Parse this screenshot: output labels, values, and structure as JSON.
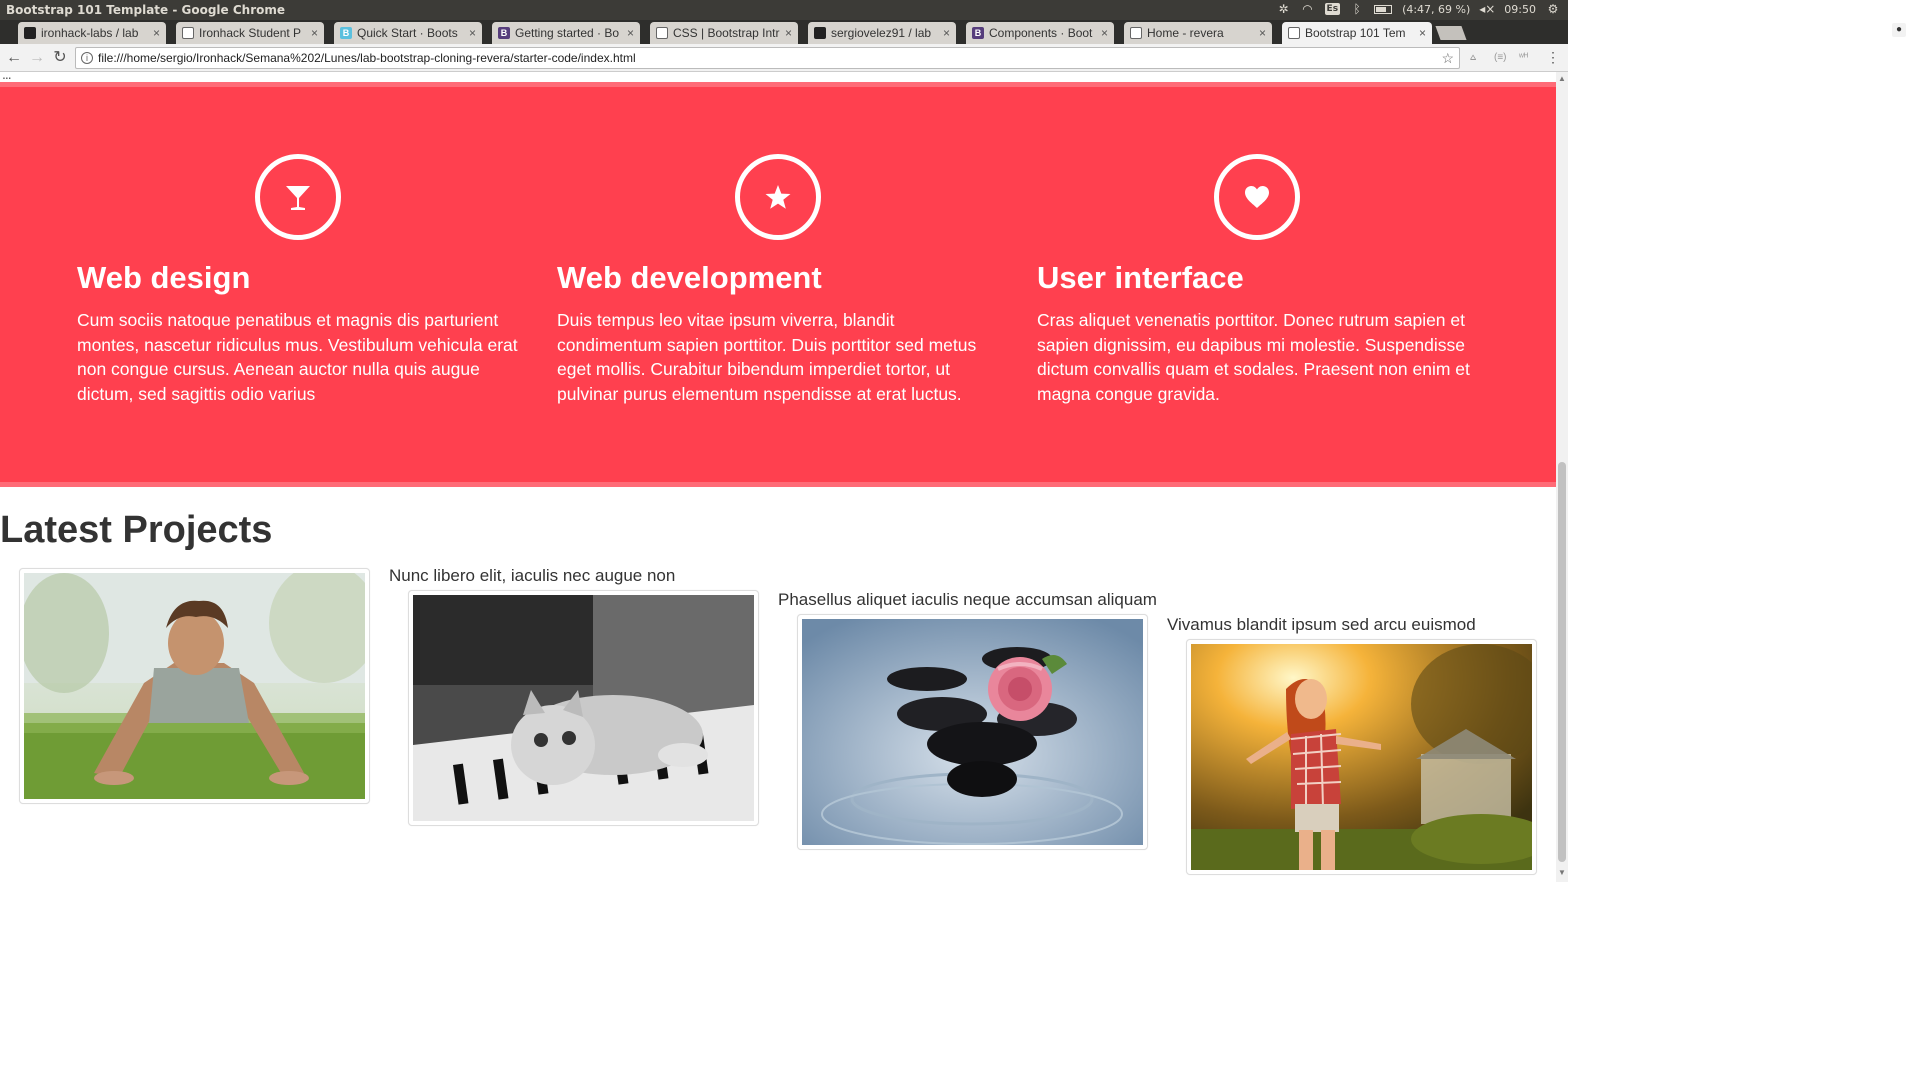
{
  "window": {
    "title": "Bootstrap 101 Template - Google Chrome"
  },
  "tray": {
    "keyboard": "Es",
    "battery": "(4:47, 69 %)",
    "clock": "09:50"
  },
  "tabs": [
    {
      "label": "ironhack-labs / lab",
      "icon": "github-icon"
    },
    {
      "label": "Ironhack Student P",
      "icon": "page-icon"
    },
    {
      "label": "Quick Start · Boots",
      "icon": "bootstrap-blue-icon"
    },
    {
      "label": "Getting started · Bo",
      "icon": "bootstrap-icon"
    },
    {
      "label": "CSS | Bootstrap Intr",
      "icon": "page-icon"
    },
    {
      "label": "sergiovelez91 / lab",
      "icon": "github-icon"
    },
    {
      "label": "Components · Boot",
      "icon": "bootstrap-icon"
    },
    {
      "label": "Home - revera",
      "icon": "page-icon"
    },
    {
      "label": "Bootstrap 101 Tem",
      "icon": "page-icon"
    }
  ],
  "address": {
    "url": "file:///home/sergio/Ironhack/Semana%202/Lunes/lab-bootstrap-cloning-revera/starter-code/index.html"
  },
  "services": [
    {
      "icon": "cocktail-glass-icon",
      "title": "Web design",
      "text": "Cum sociis natoque penatibus et magnis dis parturient montes, nascetur ridiculus mus. Vestibulum vehicula erat non congue cursus. Aenean auctor nulla quis augue dictum, sed sagittis odio varius"
    },
    {
      "icon": "star-icon",
      "title": "Web development",
      "text": "Duis tempus leo vitae ipsum viverra, blandit condimentum sapien porttitor. Duis porttitor sed metus eget mollis. Curabitur bibendum imperdiet tortor, ut pulvinar purus elementum nspendisse at erat luctus."
    },
    {
      "icon": "heart-icon",
      "title": "User interface",
      "text": "Cras aliquet venenatis porttitor. Donec rutrum sapien et sapien dignissim, eu dapibus mi molestie. Suspendisse dictum convallis quam et sodales. Praesent non enim et magna congue gravida."
    }
  ],
  "projects": {
    "title": "Latest Projects",
    "items": [
      {
        "caption": "",
        "image": "man-pushup-photo"
      },
      {
        "caption": "Nunc libero elit, iaculis nec augue non",
        "image": "kitten-piano-photo"
      },
      {
        "caption": "Phasellus aliquet iaculis neque accumsan aliquam",
        "image": "rose-stones-photo"
      },
      {
        "caption": "Vivamus blandit ipsum sed arcu euismod",
        "image": "woman-sunlight-photo"
      }
    ]
  },
  "colors": {
    "accent": "#ff404f",
    "text": "#333333"
  }
}
